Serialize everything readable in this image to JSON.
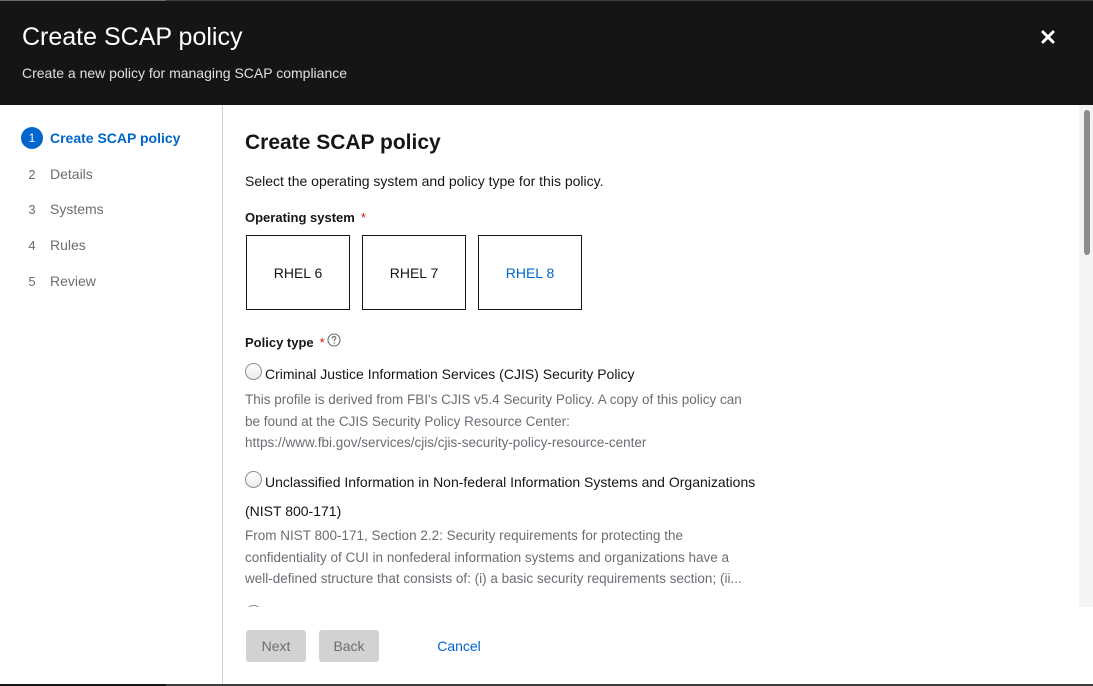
{
  "modal": {
    "title": "Create SCAP policy",
    "description": "Create a new policy for managing SCAP compliance",
    "close_icon": "close-icon"
  },
  "wizard_nav": {
    "current_step": 1,
    "steps": [
      {
        "number": "1",
        "label": "Create SCAP policy"
      },
      {
        "number": "2",
        "label": "Details"
      },
      {
        "number": "3",
        "label": "Systems"
      },
      {
        "number": "4",
        "label": "Rules"
      },
      {
        "number": "5",
        "label": "Review"
      }
    ]
  },
  "step": {
    "title": "Create SCAP policy",
    "description": "Select the operating system and policy type for this policy.",
    "os_field": {
      "label": "Operating system",
      "required_marker": "*",
      "options": [
        "RHEL 6",
        "RHEL 7",
        "RHEL 8"
      ],
      "selected": "RHEL 8"
    },
    "policy_type_field": {
      "label": "Policy type",
      "required_marker": "*",
      "help_icon": "help-circle-icon",
      "options": [
        {
          "label": "Criminal Justice Information Services (CJIS) Security Policy",
          "description_lines": [
            "This profile is derived from FBI's CJIS v5.4 Security Policy. A copy of this policy can",
            "be found at the CJIS Security Policy Resource Center:",
            "https://www.fbi.gov/services/cjis/cjis-security-policy-resource-center"
          ]
        },
        {
          "label": "Unclassified Information in Non-federal Information Systems and Organizations",
          "label_continued": "(NIST 800-171)",
          "description_lines": [
            "From NIST 800-171, Section 2.2: Security requirements for protecting the",
            "confidentiality of CUI in nonfederal information systems and organizations have a",
            "well-defined structure that consists of: (i) a basic security requirements section; (ii..."
          ]
        }
      ]
    }
  },
  "footer": {
    "next_label": "Next",
    "back_label": "Back",
    "cancel_label": "Cancel"
  },
  "colors": {
    "accent": "#0066cc",
    "header_bg": "#151515",
    "required": "#c9190b",
    "muted_text": "#6a6e73"
  }
}
